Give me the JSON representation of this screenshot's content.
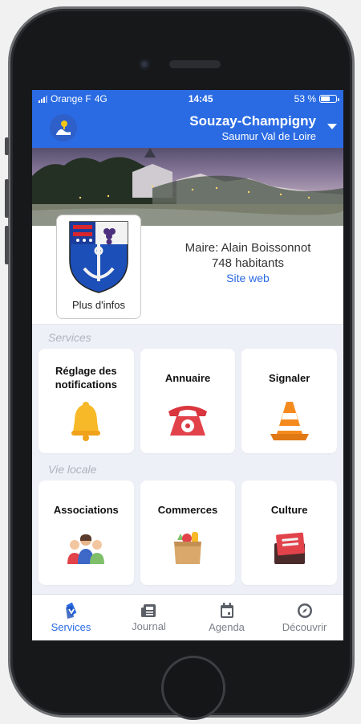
{
  "status": {
    "carrier": "Orange F",
    "network": "4G",
    "time": "14:45",
    "battery": "53 %",
    "battery_level": 0.53
  },
  "header": {
    "city": "Souzay-Champigny",
    "region": "Saumur Val de Loire"
  },
  "info": {
    "crest_label": "Plus d'infos",
    "mayor": "Maire: Alain Boissonnot",
    "population": "748 habitants",
    "website": "Site web"
  },
  "services": {
    "title": "Services",
    "tiles": [
      {
        "label": "Réglage des notifications",
        "icon": "bell-icon"
      },
      {
        "label": "Annuaire",
        "icon": "telephone-icon"
      },
      {
        "label": "Signaler",
        "icon": "traffic-cone-icon"
      }
    ]
  },
  "local": {
    "title": "Vie locale",
    "tiles": [
      {
        "label": "Associations",
        "icon": "people-icon"
      },
      {
        "label": "Commerces",
        "icon": "shopping-bag-icon"
      },
      {
        "label": "Culture",
        "icon": "books-icon"
      }
    ]
  },
  "tabs": [
    {
      "label": "Services",
      "icon": "services-icon"
    },
    {
      "label": "Journal",
      "icon": "newspaper-icon"
    },
    {
      "label": "Agenda",
      "icon": "calendar-icon"
    },
    {
      "label": "Découvrir",
      "icon": "compass-icon"
    }
  ],
  "colors": {
    "primary": "#2a6be3",
    "background": "#eef0f7",
    "inactive": "#7b7f88"
  }
}
